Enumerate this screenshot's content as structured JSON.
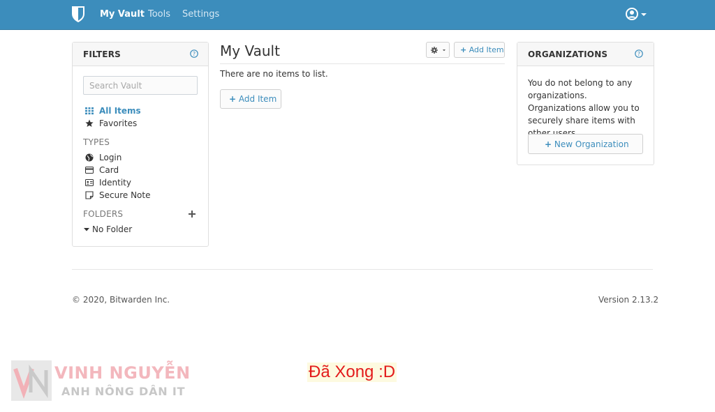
{
  "nav": {
    "links": [
      "My Vault",
      "Tools",
      "Settings"
    ]
  },
  "filters": {
    "title": "FILTERS",
    "search_placeholder": "Search Vault",
    "all_items": "All Items",
    "favorites": "Favorites",
    "types_label": "TYPES",
    "types": [
      "Login",
      "Card",
      "Identity",
      "Secure Note"
    ],
    "folders_label": "FOLDERS",
    "no_folder": "No Folder"
  },
  "vault": {
    "title": "My Vault",
    "add_item_small": "Add Item",
    "empty_message": "There are no items to list.",
    "add_item": "Add Item"
  },
  "organizations": {
    "title": "ORGANIZATIONS",
    "message": "You do not belong to any organizations. Organizations allow you to securely share items with other users.",
    "new_org": "New Organization"
  },
  "footer": {
    "copyright": "© 2020, Bitwarden Inc.",
    "version": "Version 2.13.2"
  },
  "overlay": {
    "watermark_line1": "VINH NGUYỄN",
    "watermark_line2": "ANH NÔNG DÂN IT",
    "caption": "Đã Xong :D"
  },
  "colors": {
    "navbar": "#3c8dbc",
    "link": "#3c8dbc",
    "caption": "#e31b1b"
  }
}
